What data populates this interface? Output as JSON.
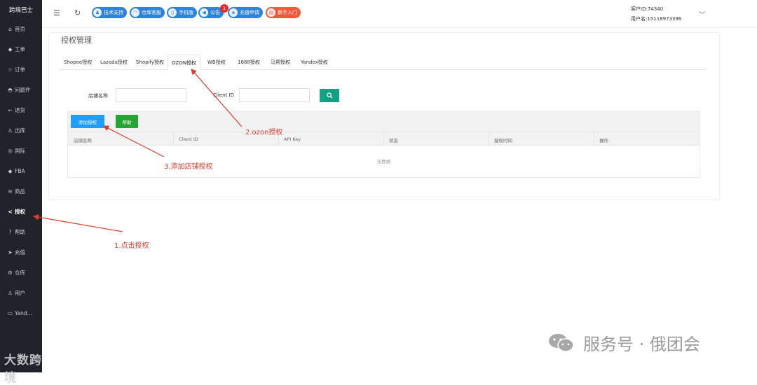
{
  "sidebar": {
    "title": "跨境巴士",
    "items": [
      {
        "icon": "home-icon",
        "glyph": "⌂",
        "label": "首页"
      },
      {
        "icon": "ticket-icon",
        "glyph": "◆",
        "label": "工单"
      },
      {
        "icon": "star-icon",
        "glyph": "☆",
        "label": "订单"
      },
      {
        "icon": "bag-icon",
        "glyph": "◓",
        "label": "问题件"
      },
      {
        "icon": "return-arrow-icon",
        "glyph": "←",
        "label": "退货"
      },
      {
        "icon": "warehouse-out-icon",
        "glyph": "♙",
        "label": "出库"
      },
      {
        "icon": "globe-icon",
        "glyph": "◎",
        "label": "国际"
      },
      {
        "icon": "diamond-icon",
        "glyph": "◆",
        "label": "FBA"
      },
      {
        "icon": "database-icon",
        "glyph": "≋",
        "label": "商品"
      },
      {
        "icon": "share-icon",
        "glyph": "<",
        "label": "授权"
      },
      {
        "icon": "question-icon",
        "glyph": "?",
        "label": "帮助"
      },
      {
        "icon": "send-icon",
        "glyph": "➤",
        "label": "充值"
      },
      {
        "icon": "gear-icon",
        "glyph": "⚙",
        "label": "仓库"
      },
      {
        "icon": "user-icon",
        "glyph": "♙",
        "label": "用户"
      },
      {
        "icon": "card-icon",
        "glyph": "▭",
        "label": "Yand..."
      }
    ],
    "active_index": 9,
    "footer": "大数跨境"
  },
  "topbar": {
    "pills": [
      {
        "icon": "support-icon",
        "label": "技术支持",
        "color": "blue"
      },
      {
        "icon": "headset-icon",
        "label": "仓库客服",
        "color": "blue"
      },
      {
        "icon": "phone-icon",
        "label": "手机版",
        "color": "blue"
      },
      {
        "icon": "megaphone-icon",
        "label": "公告",
        "color": "blue"
      },
      {
        "icon": "wallet-icon",
        "label": "充值申请",
        "color": "blue"
      },
      {
        "icon": "book-icon",
        "label": "新手入门",
        "color": "red"
      }
    ],
    "notice_badge": "1",
    "customer_id": "客户ID:74340",
    "username": "用户名:15118973396"
  },
  "card": {
    "title": "授权管理",
    "tabs": [
      "Shopee授权",
      "Lazada授权",
      "Shopify授权",
      "OZON授权",
      "WB授权",
      "1688授权",
      "马帮授权",
      "Yandex授权"
    ],
    "active_tab": 3
  },
  "search": {
    "shop_name_label": "店铺名称",
    "client_id_label": "Client ID"
  },
  "table": {
    "add_button": "添加授权",
    "help_button": "帮助",
    "columns": [
      "店铺名称",
      "Client ID",
      "API Key",
      "状态",
      "授权时间",
      "操作"
    ],
    "empty_text": "无数据"
  },
  "annotations": {
    "step1": "1.点击授权",
    "step2": "2.ozon授权",
    "step3": "3.添加店铺授权",
    "color": "#e03a2c"
  },
  "watermark": {
    "text": "服务号 · 俄团会"
  }
}
